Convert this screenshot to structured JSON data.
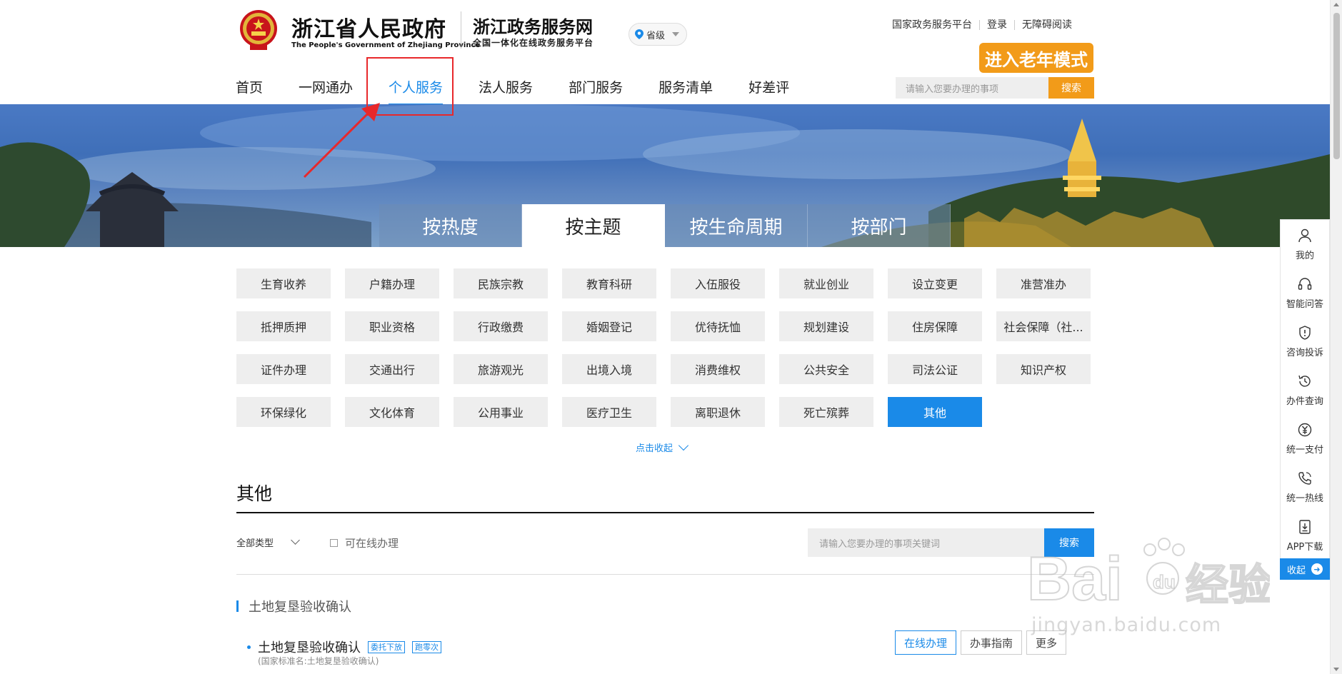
{
  "header": {
    "gov_name": "浙江省人民政府",
    "gov_name_en": "The People's Government of Zhejiang Province",
    "service_name": "浙江政务服务网",
    "service_sub": "全国一体化在线政务服务平台",
    "region": "省级",
    "top_links": [
      "国家政务服务平台",
      "登录",
      "无障碍阅读"
    ],
    "elder_mode": "进入老年模式",
    "search_placeholder": "请输入您要办理的事项",
    "search_button": "搜索"
  },
  "nav": {
    "items": [
      "首页",
      "一网通办",
      "个人服务",
      "法人服务",
      "部门服务",
      "服务清单",
      "好差评"
    ],
    "active": "个人服务"
  },
  "tabs": {
    "items": [
      "按热度",
      "按主题",
      "按生命周期",
      "按部门"
    ],
    "active": "按主题"
  },
  "themes": [
    "生育收养",
    "户籍办理",
    "民族宗教",
    "教育科研",
    "入伍服役",
    "就业创业",
    "设立变更",
    "准营准办",
    "抵押质押",
    "职业资格",
    "行政缴费",
    "婚姻登记",
    "优待抚恤",
    "规划建设",
    "住房保障",
    "社会保障（社...",
    "证件办理",
    "交通出行",
    "旅游观光",
    "出境入境",
    "消费维权",
    "公共安全",
    "司法公证",
    "知识产权",
    "环保绿化",
    "文化体育",
    "公用事业",
    "医疗卫生",
    "离职退休",
    "死亡殡葬",
    "其他"
  ],
  "active_theme": "其他",
  "collapse_label": "点击收起",
  "section": {
    "title": "其他",
    "type_filter": "全部类型",
    "online_only": "可在线办理",
    "search_placeholder": "请输入您要办理的事项关键词",
    "search_button": "搜索"
  },
  "results": {
    "group_title": "土地复垦验收确认",
    "item_name": "土地复垦验收确认",
    "tags": [
      "委托下放",
      "跑零次"
    ],
    "item_sub": "(国家标准名:土地复垦验收确认)",
    "actions": [
      "在线办理",
      "办事指南",
      "更多"
    ]
  },
  "sidebar": {
    "items": [
      {
        "label": "我的",
        "icon": "user-icon"
      },
      {
        "label": "智能问答",
        "icon": "headset-icon"
      },
      {
        "label": "咨询投诉",
        "icon": "shield-alert-icon"
      },
      {
        "label": "办件查询",
        "icon": "history-icon"
      },
      {
        "label": "统一支付",
        "icon": "yuan-icon"
      },
      {
        "label": "统一热线",
        "icon": "phone-icon"
      },
      {
        "label": "APP下载",
        "icon": "download-icon"
      }
    ],
    "collapse": "收起"
  },
  "watermark": "jingyan.baidu.com",
  "colors": {
    "accent": "#1a8ae8",
    "orange": "#f29b19",
    "highlight": "#e8282b"
  }
}
